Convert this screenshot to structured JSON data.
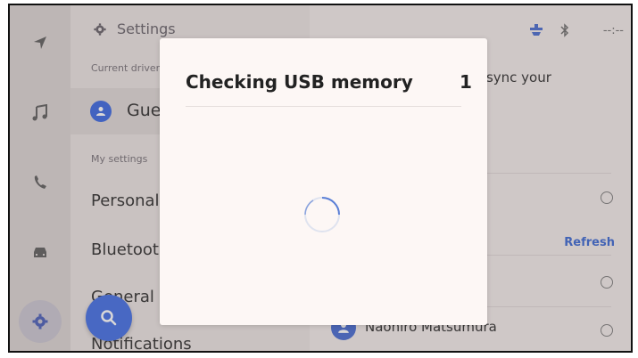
{
  "status": {
    "time": "--:--"
  },
  "panel": {
    "title": "Settings",
    "current_driver_label": "Current driver",
    "driver_name": "Guest",
    "my_settings_label": "My settings",
    "items": [
      "Personal",
      "Bluetooth",
      "General",
      "Notifications"
    ]
  },
  "right": {
    "sync_text": "o sync your",
    "refresh_label": "Refresh",
    "user_name": "Naohiro Matsumura"
  },
  "dialog": {
    "title": "Checking USB memory",
    "count": "1"
  },
  "colors": {
    "accent": "#3766e4",
    "scrim": "rgba(120,110,112,0.28)"
  },
  "icons": [
    "navigation-icon",
    "music-icon",
    "phone-icon",
    "car-icon",
    "gear-icon",
    "search-icon",
    "bluetooth-icon",
    "steering-wheel-icon"
  ]
}
